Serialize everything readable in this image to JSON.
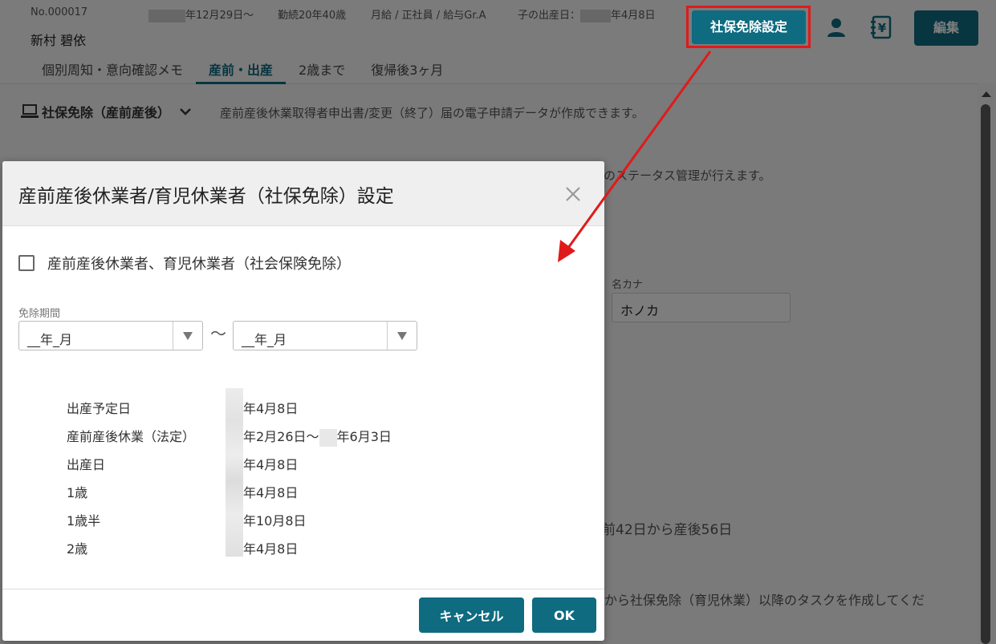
{
  "header": {
    "emp_no": "No.000017",
    "join_date_suffix": "年12月29日〜",
    "tenure_age": "勤続20年40歳",
    "employment": "月給 / 正社員 / 給与Gr.A",
    "child_birth_label": "子の出産日：",
    "child_birth_suffix": "年4月8日",
    "name": "新村 碧依",
    "tabs": [
      "個別周知・意向確認メモ",
      "産前・出産",
      "2歳まで",
      "復帰後3ヶ月"
    ],
    "shaho_button": "社保免除設定",
    "edit_button": "編集"
  },
  "content": {
    "section_title": "社保免除（産前産後）",
    "section_desc": "産前産後休業取得者申出書/変更（終了）届の電子申請データが作成できます。",
    "status_desc": "のステータス管理が行えます。",
    "kana_label": "名カナ",
    "kana_value": "ホノカ",
    "period_note": "前42日から産後56日",
    "bottom_note": "から社保免除（育児休業）以降のタスクを作成してくだ"
  },
  "dialog": {
    "title": "産前産後休業者/育児休業者（社保免除）設定",
    "checkbox_label": "産前産後休業者、育児休業者（社会保険免除）",
    "period_label": "免除期間",
    "select_from": "__年_月",
    "tilde": "〜",
    "select_to": "__年_月",
    "rows": [
      {
        "label": "出産予定日",
        "value": "年4月8日"
      },
      {
        "label": "産前産後休業（法定）",
        "value": "年2月26日〜",
        "value2": "年6月3日"
      },
      {
        "label": "出産日",
        "value": "年4月8日"
      },
      {
        "label": "1歳",
        "value": "年4月8日"
      },
      {
        "label": "1歳半",
        "value": "年10月8日"
      },
      {
        "label": "2歳",
        "value": "年4月8日"
      }
    ],
    "cancel_button": "キャンセル",
    "ok_button": "OK"
  },
  "colors": {
    "accent": "#0e6b80",
    "highlight": "#e01a1a"
  }
}
